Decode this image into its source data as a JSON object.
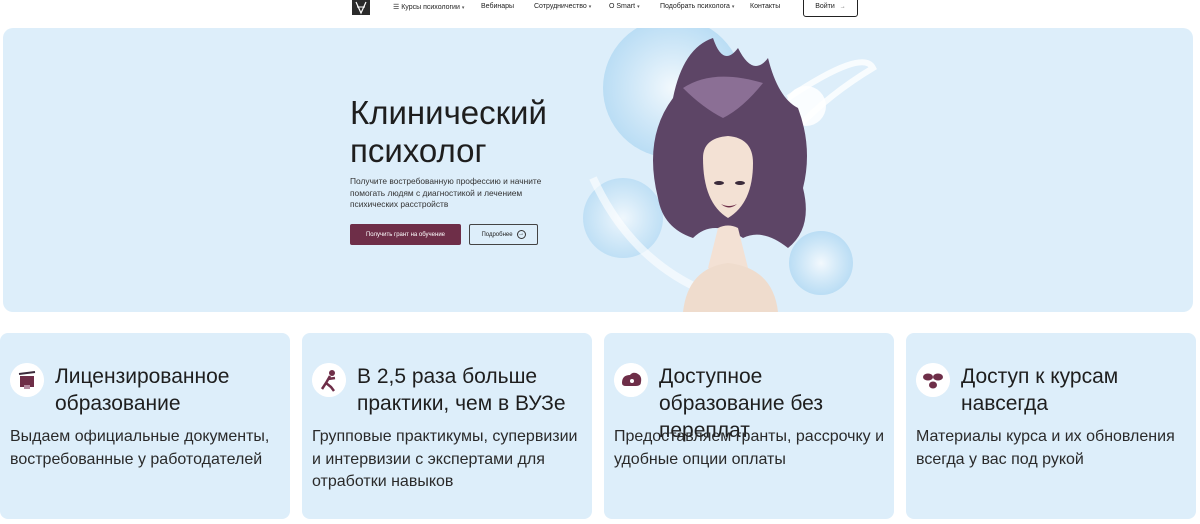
{
  "nav": {
    "logo_icon": "brand-logo-icon",
    "items": [
      {
        "label": "☰ Курсы психологии",
        "caret": "▾"
      },
      {
        "label": "Вебинары",
        "caret": ""
      },
      {
        "label": "Сотрудничество",
        "caret": "▾"
      },
      {
        "label": "О Smart",
        "caret": "▾"
      },
      {
        "label": "Подобрать психолога",
        "caret": "▾"
      },
      {
        "label": "Контакты",
        "caret": ""
      }
    ],
    "login_label": "Войти",
    "login_icon": "→"
  },
  "hero": {
    "title": "Клинический психолог",
    "subtitle": "Получите востребованную профессию и начните помогать людям с диагностикой и лечением психических расстройств",
    "primary_button": "Получить грант на обучение",
    "secondary_button": "Подробнее",
    "secondary_icon": "→",
    "illustration": "woman-portrait-illustration",
    "colors": {
      "background": "#ddeefa",
      "accent": "#6e2e48"
    }
  },
  "features": [
    {
      "icon": "license-icon",
      "title": "Лицензированное образование",
      "text": "Выдаем официальные документы, востребованные у работодателей"
    },
    {
      "icon": "practice-icon",
      "title": "В 2,5 раза больше практики, чем в ВУЗе",
      "text": "Групповые практикумы, супервизии и интервизии с экспертами для отработки навыков"
    },
    {
      "icon": "affordable-icon",
      "title": "Доступное образование без переплат",
      "text": "Предоставляем гранты, рассрочку и удобные опции оплаты"
    },
    {
      "icon": "access-forever-icon",
      "title": "Доступ к курсам навсегда",
      "text": "Материалы курса и их обновления всегда у вас под рукой"
    }
  ]
}
